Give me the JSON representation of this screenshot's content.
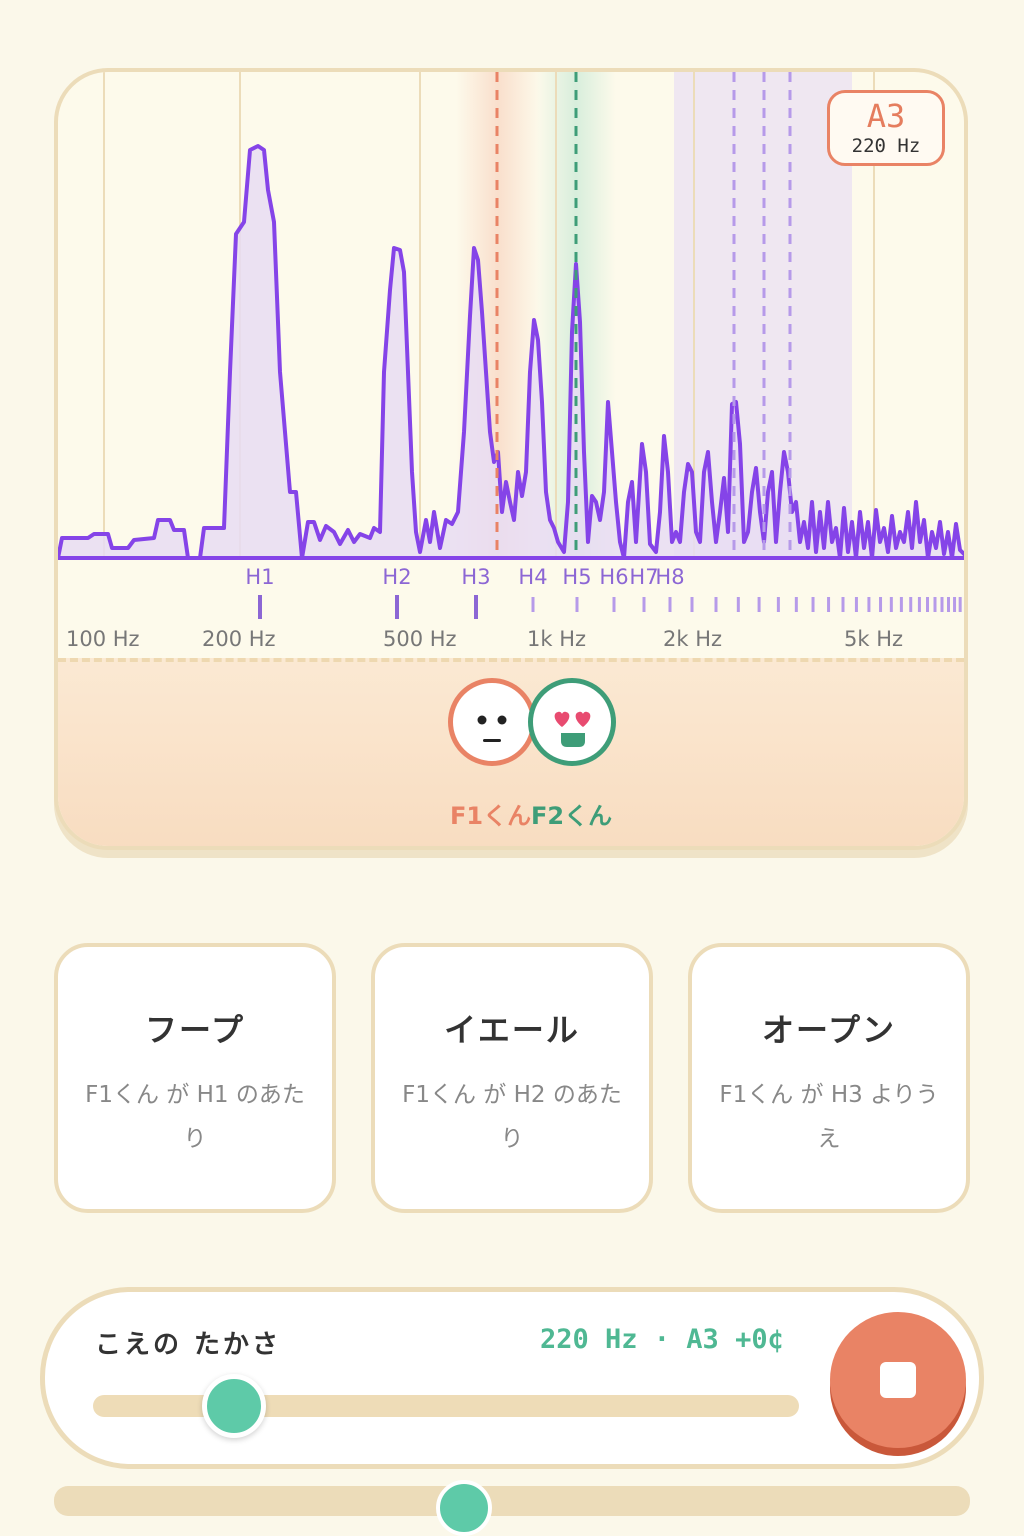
{
  "spectrum": {
    "pitch_note": "A3",
    "pitch_hz": "220 Hz",
    "harmonic_labels": [
      "H1",
      "H2",
      "H3",
      "H4",
      "H5",
      "H6",
      "H7",
      "H8"
    ],
    "freq_ticks": [
      "100 Hz",
      "200 Hz",
      "500 Hz",
      "1k Hz",
      "2k Hz",
      "5k Hz"
    ],
    "colors": {
      "line": "#8544e8",
      "fill": "#e7dcf3",
      "f1": "#e98365",
      "f2": "#3e9d78"
    }
  },
  "formants": {
    "f1_label": "F1くん",
    "f2_label": "F2くん",
    "f1_icon": "neutral-face-icon",
    "f2_icon": "heart-eyes-face-icon"
  },
  "modes": [
    {
      "title": "フープ",
      "desc": "F1くん が H1 のあたり"
    },
    {
      "title": "イエール",
      "desc": "F1くん が H2 のあたり"
    },
    {
      "title": "オープン",
      "desc": "F1くん が H3 よりうえ"
    }
  ],
  "pitch_control": {
    "label": "こえの たかさ",
    "readout": "220 Hz · A3 +0¢",
    "slider_fraction": 0.2,
    "stop_icon": "stop-icon"
  }
}
